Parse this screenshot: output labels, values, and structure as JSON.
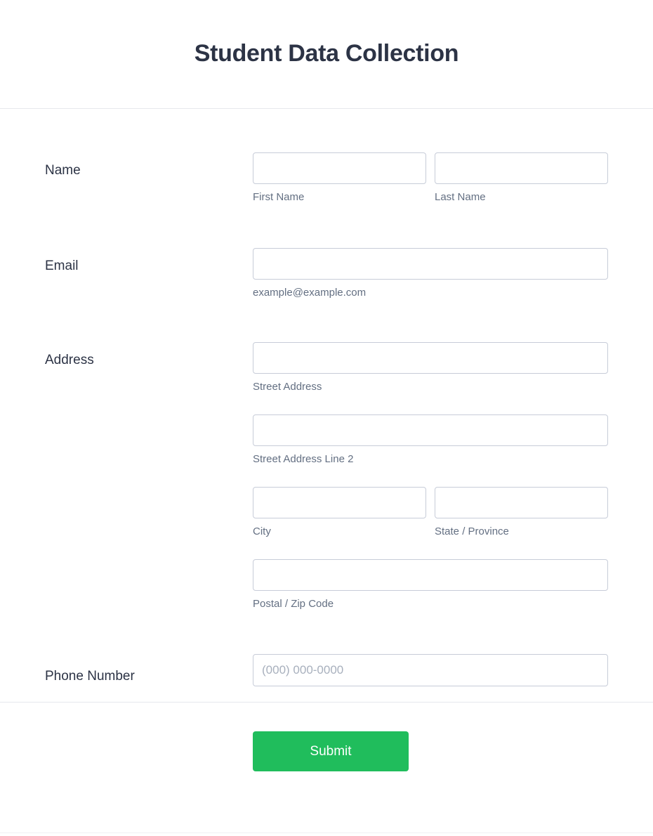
{
  "header": {
    "title": "Student Data Collection"
  },
  "theme": {
    "title_color": "#2c3345",
    "label_color": "#2c3345",
    "sublabel_color": "#636f82",
    "input_border_color": "#c7ccd8",
    "placeholder_color": "#a8b0bd",
    "submit_color": "#20bd5c",
    "divider_color": "#e6e8ed",
    "page_background": "#ffffff"
  },
  "fields": {
    "name": {
      "label": "Name",
      "first": {
        "sublabel": "First Name",
        "value": "",
        "placeholder": ""
      },
      "last": {
        "sublabel": "Last Name",
        "value": "",
        "placeholder": ""
      }
    },
    "email": {
      "label": "Email",
      "sublabel": "example@example.com",
      "value": "",
      "placeholder": ""
    },
    "address": {
      "label": "Address",
      "street": {
        "sublabel": "Street Address",
        "value": "",
        "placeholder": ""
      },
      "street2": {
        "sublabel": "Street Address Line 2",
        "value": "",
        "placeholder": ""
      },
      "city": {
        "sublabel": "City",
        "value": "",
        "placeholder": ""
      },
      "state": {
        "sublabel": "State / Province",
        "value": "",
        "placeholder": ""
      },
      "postal": {
        "sublabel": "Postal / Zip Code",
        "value": "",
        "placeholder": ""
      }
    },
    "phone": {
      "label": "Phone Number",
      "value": "",
      "placeholder": "(000) 000-0000"
    }
  },
  "footer": {
    "submit_label": "Submit"
  }
}
